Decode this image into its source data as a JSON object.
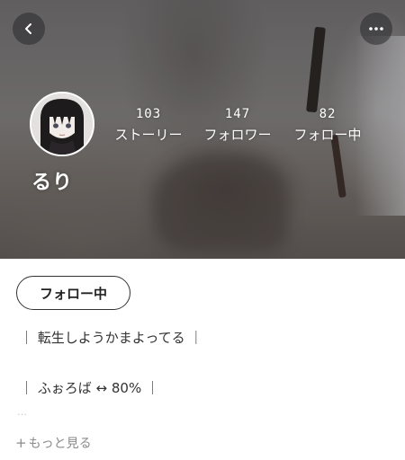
{
  "profile": {
    "username": "るり",
    "stats": [
      {
        "count": "103",
        "label": "ストーリー"
      },
      {
        "count": "147",
        "label": "フォロワー"
      },
      {
        "count": "82",
        "label": "フォロー中"
      }
    ],
    "follow_button_label": "フォロー中",
    "bio_lines": [
      "｜ 転生しようかまよってる ｜",
      "｜ ふぉろば ↔ 80% ｜"
    ],
    "bio_truncation": "…",
    "show_more_label": "もっと見る"
  },
  "icons": {
    "back": "chevron-left-icon",
    "more": "more-horizontal-icon",
    "show_more": "plus-icon"
  },
  "colors": {
    "text_primary": "#333333",
    "text_muted": "#8a8a8a",
    "button_border": "#333333"
  }
}
